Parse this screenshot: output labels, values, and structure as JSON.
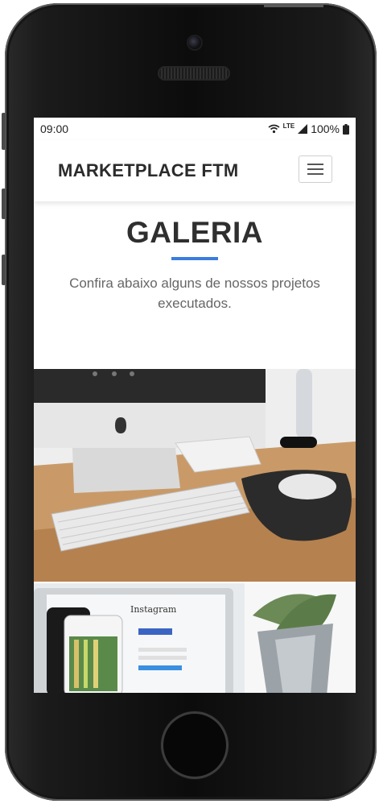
{
  "status_bar": {
    "time": "09:00",
    "network": "LTE",
    "battery": "100%"
  },
  "navbar": {
    "brand": "MARKETPLACE FTM",
    "menu_icon": "hamburger-menu-icon"
  },
  "section": {
    "title": "GALERIA",
    "subtitle": "Confira abaixo alguns de nossos projetos executados."
  },
  "gallery": {
    "items": [
      {
        "icon": "photo-desk-imac-keyboard-mouse"
      },
      {
        "icon": "photo-laptop-phone-instagram"
      }
    ],
    "instagram_text": "Instagram"
  },
  "colors": {
    "accent": "#3b7ddd",
    "title": "#2f2f2f",
    "subtitle": "#666666"
  }
}
